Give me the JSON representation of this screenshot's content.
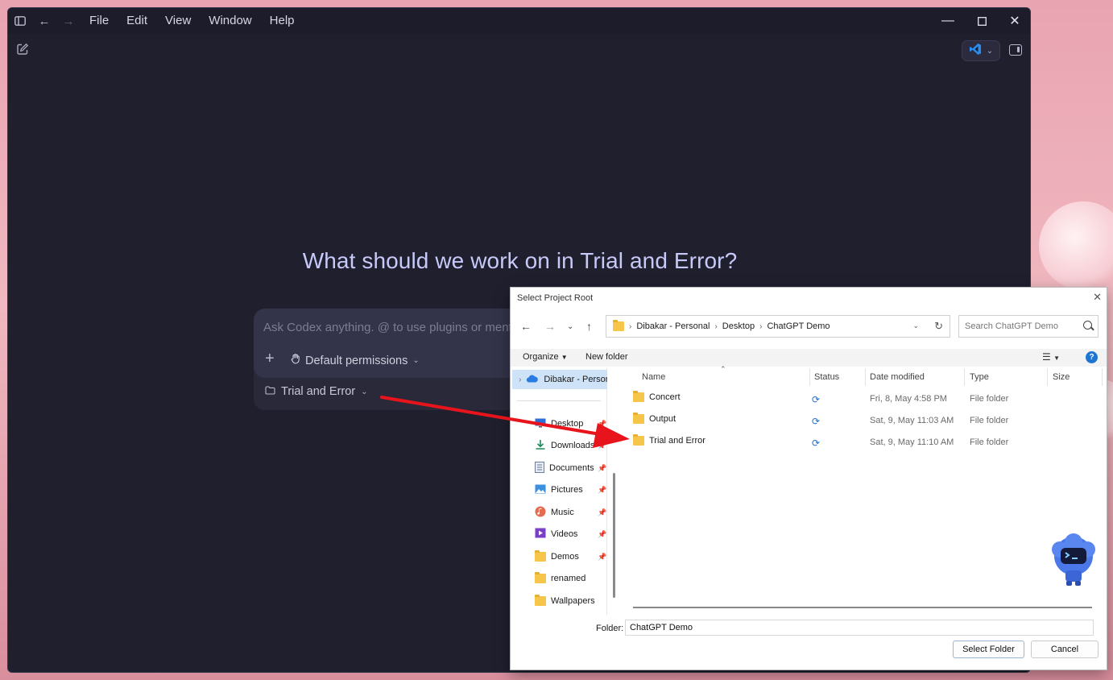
{
  "menubar": {
    "items": [
      "File",
      "Edit",
      "View",
      "Window",
      "Help"
    ]
  },
  "main": {
    "heading": "What should we work on in Trial and Error?",
    "composer_placeholder": "Ask Codex anything. @ to use plugins or mention files",
    "permissions_label": "Default permissions",
    "project_label": "Trial and Error"
  },
  "dialog": {
    "title": "Select Project Root",
    "breadcrumbs": [
      "Dibakar - Personal",
      "Desktop",
      "ChatGPT Demo"
    ],
    "search_placeholder": "Search ChatGPT Demo",
    "organize_label": "Organize",
    "new_folder_label": "New folder",
    "nav_top": "Dibakar - Personal",
    "nav_items": [
      {
        "label": "Desktop",
        "icon": "desktop-icon",
        "pinned": true
      },
      {
        "label": "Downloads",
        "icon": "download-icon",
        "pinned": true
      },
      {
        "label": "Documents",
        "icon": "documents-icon",
        "pinned": true
      },
      {
        "label": "Pictures",
        "icon": "pictures-icon",
        "pinned": true
      },
      {
        "label": "Music",
        "icon": "music-icon",
        "pinned": true
      },
      {
        "label": "Videos",
        "icon": "videos-icon",
        "pinned": true
      },
      {
        "label": "Demos",
        "icon": "folder-icon",
        "pinned": true
      },
      {
        "label": "renamed",
        "icon": "folder-icon",
        "pinned": false
      },
      {
        "label": "Wallpapers",
        "icon": "folder-icon",
        "pinned": false
      }
    ],
    "columns": [
      "Name",
      "Status",
      "Date modified",
      "Type",
      "Size"
    ],
    "rows": [
      {
        "name": "Concert",
        "date": "Fri, 8, May 4:58 PM",
        "type": "File folder"
      },
      {
        "name": "Output",
        "date": "Sat, 9, May 11:03 AM",
        "type": "File folder"
      },
      {
        "name": "Trial and Error",
        "date": "Sat, 9, May 11:10 AM",
        "type": "File folder"
      }
    ],
    "folder_label": "Folder:",
    "folder_value": "ChatGPT Demo",
    "select_button": "Select Folder",
    "cancel_button": "Cancel"
  },
  "colors": {
    "app_bg": "#1f1f2e",
    "heading": "#c7c9f8",
    "accent_blue": "#1f76d2",
    "annotation_arrow": "#e8141b"
  }
}
